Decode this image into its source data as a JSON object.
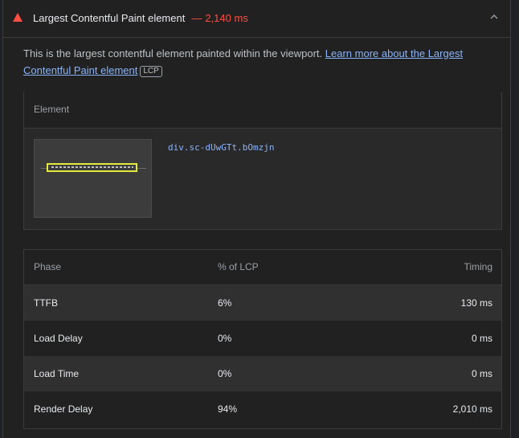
{
  "audit": {
    "title": "Largest Contentful Paint element",
    "separator": "—",
    "value": "2,140 ms",
    "description": "This is the largest contentful element painted within the viewport.",
    "learn_more": "Learn more about the Largest Contentful Paint element",
    "tag": "LCP"
  },
  "element_table": {
    "header": "Element",
    "selector": "div.sc-dUwGTt.bOmzjn"
  },
  "phase_table": {
    "headers": [
      "Phase",
      "% of LCP",
      "Timing"
    ],
    "rows": [
      {
        "phase": "TTFB",
        "pct": "6%",
        "timing": "130 ms"
      },
      {
        "phase": "Load Delay",
        "pct": "0%",
        "timing": "0 ms"
      },
      {
        "phase": "Load Time",
        "pct": "0%",
        "timing": "0 ms"
      },
      {
        "phase": "Render Delay",
        "pct": "94%",
        "timing": "2,010 ms"
      }
    ]
  },
  "icons": {
    "status": "warning-triangle-icon",
    "toggle": "chevron-up-icon"
  },
  "colors": {
    "fail": "#ff4e42",
    "link": "#8ab4f8",
    "highlight": "#e4ea3b"
  }
}
